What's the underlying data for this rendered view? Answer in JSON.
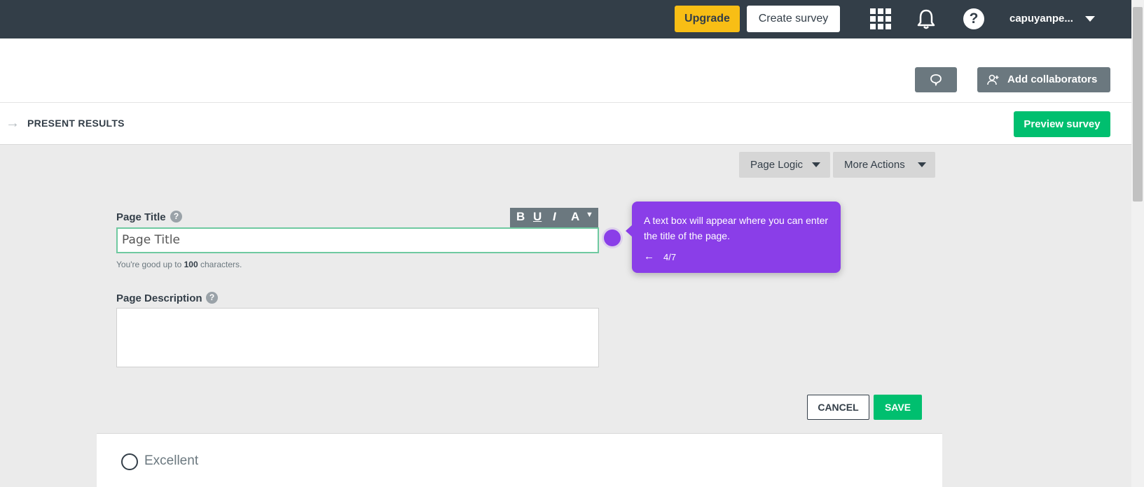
{
  "topnav": {
    "upgrade_label": "Upgrade",
    "create_label": "Create survey",
    "username": "capuyanpe...",
    "icons": [
      "apps-icon",
      "bell-icon",
      "help-icon",
      "caret-down-icon"
    ]
  },
  "header": {
    "collaborators_label": "Add collaborators",
    "comment_icon": "comment-icon"
  },
  "steps": {
    "current_label": "PRESENT RESULTS",
    "preview_label": "Preview survey"
  },
  "edit_panel": {
    "page_logic_label": "Page Logic",
    "more_actions_label": "More Actions",
    "title_label": "Page Title",
    "title_value": "Page Title",
    "toolbar": {
      "bold": "B",
      "underline": "U",
      "italic": "I",
      "color": "A"
    },
    "helper_prefix": "You're good up to ",
    "helper_count": "100",
    "helper_suffix": " characters.",
    "description_label": "Page Description",
    "cancel_label": "CANCEL",
    "save_label": "SAVE"
  },
  "question": {
    "option_label": "Excellent"
  },
  "tour": {
    "text": "A text box will appear where you can enter the title of the page.",
    "back": "←",
    "step": "4/7"
  },
  "colors": {
    "nav_bg": "#333e48",
    "upgrade": "#f8be15",
    "accent_green": "#00bf6f",
    "tour_purple": "#8a3ee8"
  }
}
